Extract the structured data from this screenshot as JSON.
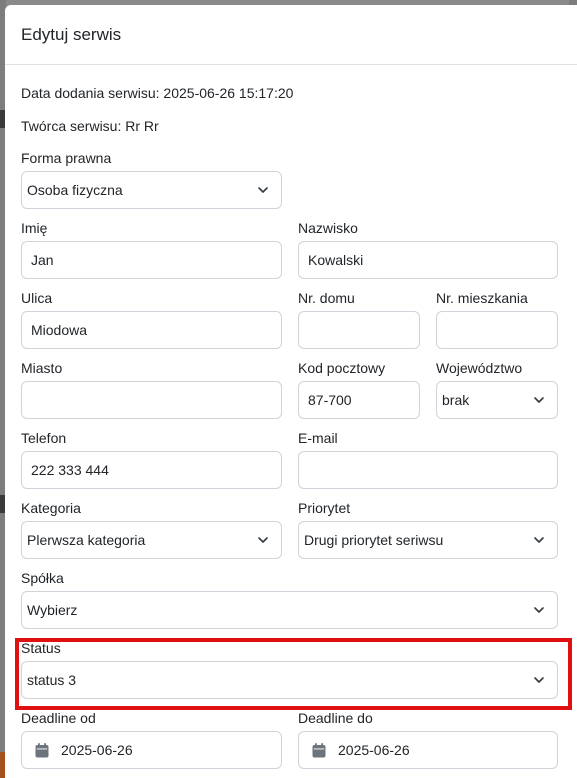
{
  "modal": {
    "title": "Edytuj serwis",
    "date_added_label": "Data dodania serwisu:",
    "date_added_value": "2025-06-26 15:17:20",
    "creator_label": "Twórca serwisu:",
    "creator_value": "Rr Rr"
  },
  "form": {
    "legal_form": {
      "label": "Forma prawna",
      "value": "Osoba fizyczna"
    },
    "first_name": {
      "label": "Imię",
      "value": "Jan"
    },
    "last_name": {
      "label": "Nazwisko",
      "value": "Kowalski"
    },
    "street": {
      "label": "Ulica",
      "value": "Miodowa"
    },
    "house_no": {
      "label": "Nr. domu",
      "value": ""
    },
    "apartment_no": {
      "label": "Nr. mieszkania",
      "value": ""
    },
    "city": {
      "label": "Miasto",
      "value": ""
    },
    "postal_code": {
      "label": "Kod pocztowy",
      "value": "87-700"
    },
    "voivodeship": {
      "label": "Województwo",
      "value": "brak"
    },
    "phone": {
      "label": "Telefon",
      "value": "222 333 444"
    },
    "email": {
      "label": "E-mail",
      "value": ""
    },
    "category": {
      "label": "Kategoria",
      "value": "Plerwsza kategoria"
    },
    "priority": {
      "label": "Priorytet",
      "value": "Drugi priorytet seriwsu"
    },
    "company": {
      "label": "Spółka",
      "value": "Wybierz"
    },
    "status": {
      "label": "Status",
      "value": "status 3"
    },
    "deadline_from": {
      "label": "Deadline od",
      "value": "2025-06-26"
    },
    "deadline_to": {
      "label": "Deadline do",
      "value": "2025-06-26"
    }
  },
  "icons": {
    "select": "chevron-down-icon",
    "date": "calendar-icon"
  },
  "colors": {
    "highlight": "#e01010",
    "border": "#ced4da"
  }
}
